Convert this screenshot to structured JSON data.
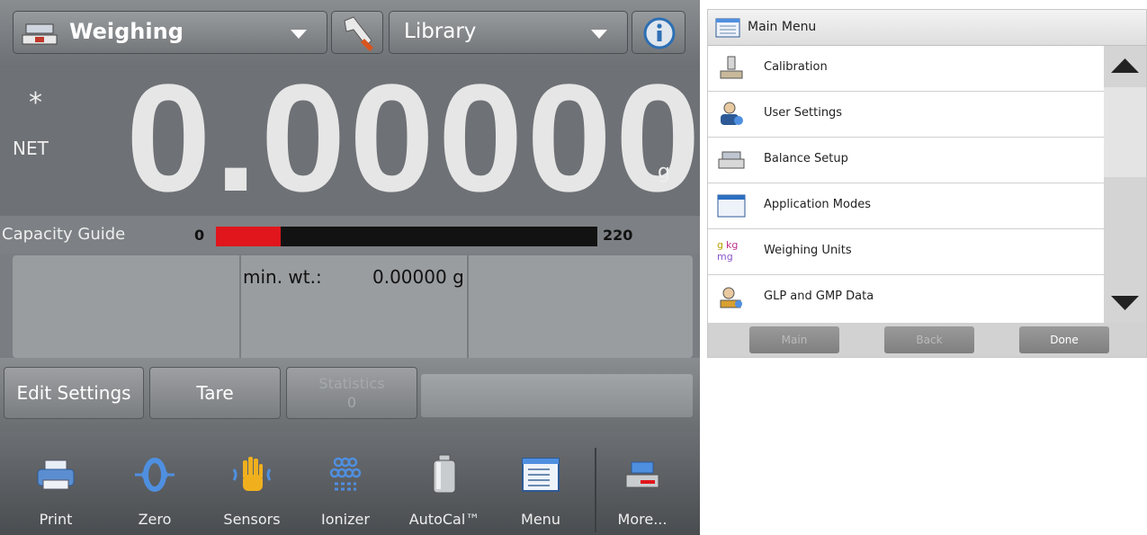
{
  "header": {
    "mode_label": "Weighing",
    "library_label": "Library"
  },
  "readout": {
    "stable_marker": "*",
    "net_label": "NET",
    "weight": "0.00000",
    "unit": "g"
  },
  "capacity": {
    "label": "Capacity Guide",
    "min": "0",
    "max": "220",
    "fill_fraction": 0.17,
    "fill_color": "#e0161c"
  },
  "info_panel": {
    "min_wt_label": "min. wt.:",
    "min_wt_value": "0.00000 g"
  },
  "softkeys": {
    "edit_settings": "Edit Settings",
    "tare": "Tare",
    "statistics": "Statistics",
    "statistics_count": "0"
  },
  "toolbar": [
    {
      "label": "Print",
      "icon": "printer-icon"
    },
    {
      "label": "Zero",
      "icon": "zero-icon"
    },
    {
      "label": "Sensors",
      "icon": "hand-sensor-icon"
    },
    {
      "label": "Ionizer",
      "icon": "ionizer-icon"
    },
    {
      "label": "AutoCal™",
      "icon": "calibration-weight-icon"
    },
    {
      "label": "Menu",
      "icon": "menu-list-icon"
    },
    {
      "label": "More...",
      "icon": "more-icon"
    }
  ],
  "main_menu": {
    "title": "Main Menu",
    "items": [
      {
        "label": "Calibration",
        "icon": "calibration-icon"
      },
      {
        "label": "User Settings",
        "icon": "user-settings-icon"
      },
      {
        "label": "Balance Setup",
        "icon": "balance-setup-icon"
      },
      {
        "label": "Application Modes",
        "icon": "application-modes-icon"
      },
      {
        "label": "Weighing Units",
        "icon": "weighing-units-icon",
        "icon_text": "g kg mg"
      },
      {
        "label": "GLP and GMP Data",
        "icon": "glp-data-icon"
      }
    ],
    "footer": {
      "main": "Main",
      "back": "Back",
      "done": "Done"
    }
  }
}
